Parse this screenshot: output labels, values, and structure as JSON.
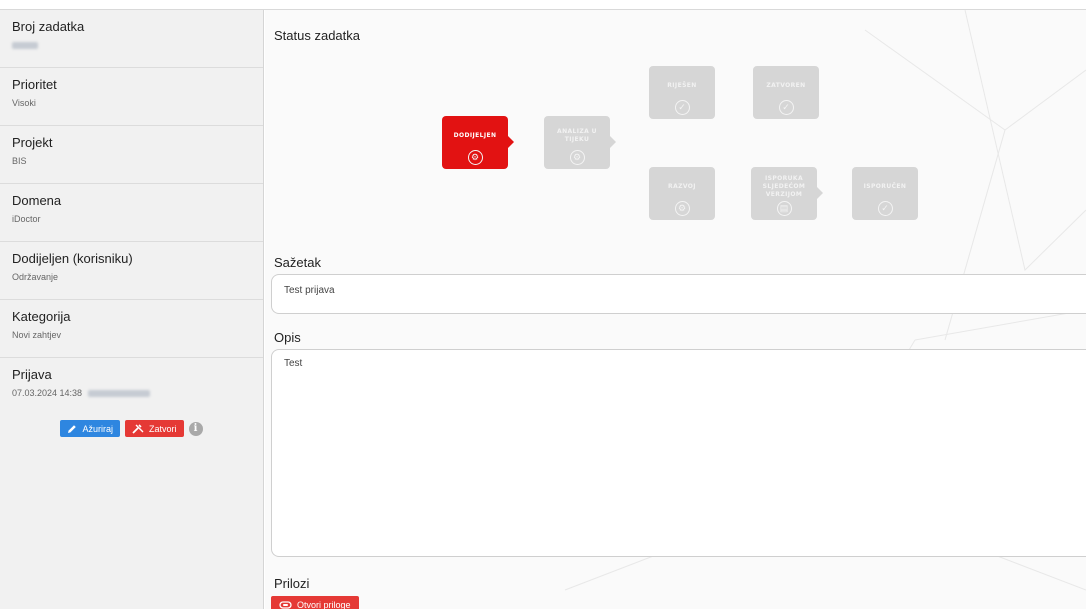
{
  "sidebar": {
    "fields": [
      {
        "label": "Broj zadatka",
        "value": ""
      },
      {
        "label": "Prioritet",
        "value": "Visoki"
      },
      {
        "label": "Projekt",
        "value": "BIS"
      },
      {
        "label": "Domena",
        "value": "iDoctor"
      },
      {
        "label": "Dodijeljen (korisniku)",
        "value": "Održavanje"
      },
      {
        "label": "Kategorija",
        "value": "Novi zahtjev"
      },
      {
        "label": "Prijava",
        "value": "07.03.2024 14:38"
      }
    ],
    "actions": {
      "update_label": "Ažuriraj",
      "close_label": "Zatvori",
      "info_glyph": "i"
    }
  },
  "main": {
    "status_title": "Status zadatka",
    "workflow": {
      "states": [
        {
          "label": "DODIJELJEN",
          "active": true,
          "icon": "gear-circle-icon"
        },
        {
          "label": "ANALIZA U TIJEKU",
          "active": false,
          "icon": "gear-circle-icon"
        },
        {
          "label": "RIJEŠEN",
          "active": false,
          "icon": "check-circle-icon"
        },
        {
          "label": "ZATVOREN",
          "active": false,
          "icon": "check-circle-icon"
        },
        {
          "label": "RAZVOJ",
          "active": false,
          "icon": "gear-circle-icon"
        },
        {
          "label": "ISPORUKA SLJEDEĆOM VERZIJOM",
          "active": false,
          "icon": "doc-circle-icon"
        },
        {
          "label": "ISPORUČEN",
          "active": false,
          "icon": "check-circle-icon"
        }
      ],
      "active_color": "#e21212",
      "inactive_color": "#d6d6d6"
    },
    "summary_label": "Sažetak",
    "summary_value": "Test prijava",
    "description_label": "Opis",
    "description_value": "Test",
    "attachments_label": "Prilozi",
    "attachments_button": "Otvori priloge"
  },
  "colors": {
    "primary_blue": "#2e86e0",
    "danger_red": "#e53935",
    "sidebar_bg": "#f1f1f1"
  }
}
